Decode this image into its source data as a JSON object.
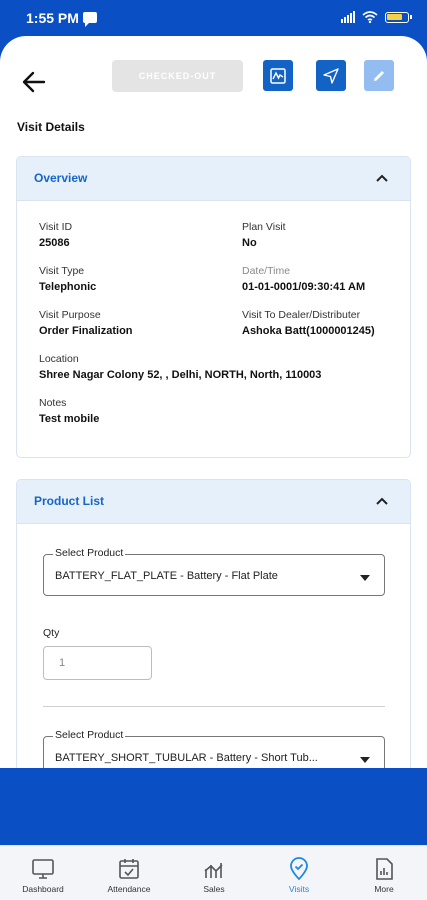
{
  "status_bar": {
    "time": "1:55 PM"
  },
  "toolbar": {
    "checkout_label": "CHECKED-OUT"
  },
  "page": {
    "title": "Visit Details"
  },
  "overview": {
    "title": "Overview",
    "fields": {
      "visit_id": {
        "label": "Visit ID",
        "value": "25086"
      },
      "plan_visit": {
        "label": "Plan Visit",
        "value": "No"
      },
      "visit_type": {
        "label": "Visit Type",
        "value": "Telephonic"
      },
      "date_time": {
        "label": "Date/Time",
        "value": "01-01-0001/09:30:41 AM"
      },
      "visit_purpose": {
        "label": "Visit Purpose",
        "value": "Order Finalization"
      },
      "visit_to": {
        "label": "Visit To Dealer/Distributer",
        "value": "Ashoka Batt(1000001245)"
      },
      "location": {
        "label": "Location",
        "value": "Shree Nagar Colony 52, , Delhi, NORTH, North, 110003"
      },
      "notes": {
        "label": "Notes",
        "value": "Test mobile"
      }
    }
  },
  "product_list": {
    "title": "Product List",
    "items": [
      {
        "select_label": "Select Product",
        "selected": "BATTERY_FLAT_PLATE - Battery - Flat Plate",
        "qty_label": "Qty",
        "qty_value": "1"
      },
      {
        "select_label": "Select Product",
        "selected": "BATTERY_SHORT_TUBULAR - Battery - Short Tub..."
      }
    ]
  },
  "bottom_nav": [
    {
      "label": "Dashboard",
      "icon": "monitor-icon",
      "active": false
    },
    {
      "label": "Attendance",
      "icon": "calendar-check-icon",
      "active": false
    },
    {
      "label": "Sales",
      "icon": "sales-chart-icon",
      "active": false
    },
    {
      "label": "Visits",
      "icon": "location-pin-icon",
      "active": true
    },
    {
      "label": "More",
      "icon": "document-chart-icon",
      "active": false
    }
  ],
  "colors": {
    "brand_blue": "#0b4fc4",
    "accent": "#1665c8",
    "active_nav": "#1e88e5"
  }
}
